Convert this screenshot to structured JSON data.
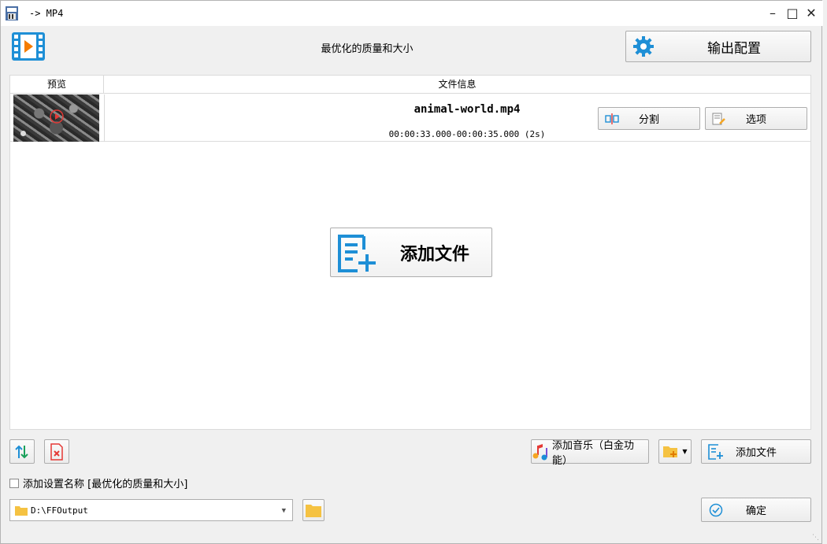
{
  "window": {
    "title": "-> MP4",
    "app_icon": "mp4-file-icon",
    "controls": [
      "minimize-icon",
      "maximize-icon",
      "close-icon"
    ]
  },
  "header": {
    "format_icon": "video-file-icon",
    "profile_name": "最优化的质量和大小",
    "output_settings_label": "输出配置"
  },
  "list": {
    "columns": {
      "preview": "预览",
      "info": "文件信息"
    },
    "rows": [
      {
        "filename": "animal-world.mp4",
        "time_range": "00:00:33.000-00:00:35.000 (2s)",
        "split_label": "分割",
        "options_label": "选项"
      }
    ],
    "add_file_label": "添加文件"
  },
  "bottom": {
    "add_music_label": "添加音乐（白金功能）",
    "add_file_label": "添加文件",
    "add_setting_name_label": "添加设置名称 [最优化的质量和大小]",
    "add_setting_name_checked": false,
    "output_path": "D:\\FFOutput",
    "ok_label": "确定"
  },
  "colors": {
    "accent_blue": "#1e8fd6",
    "video_orange": "#f57c00",
    "folder_yellow": "#f5c242",
    "delete_red": "#e53935"
  }
}
